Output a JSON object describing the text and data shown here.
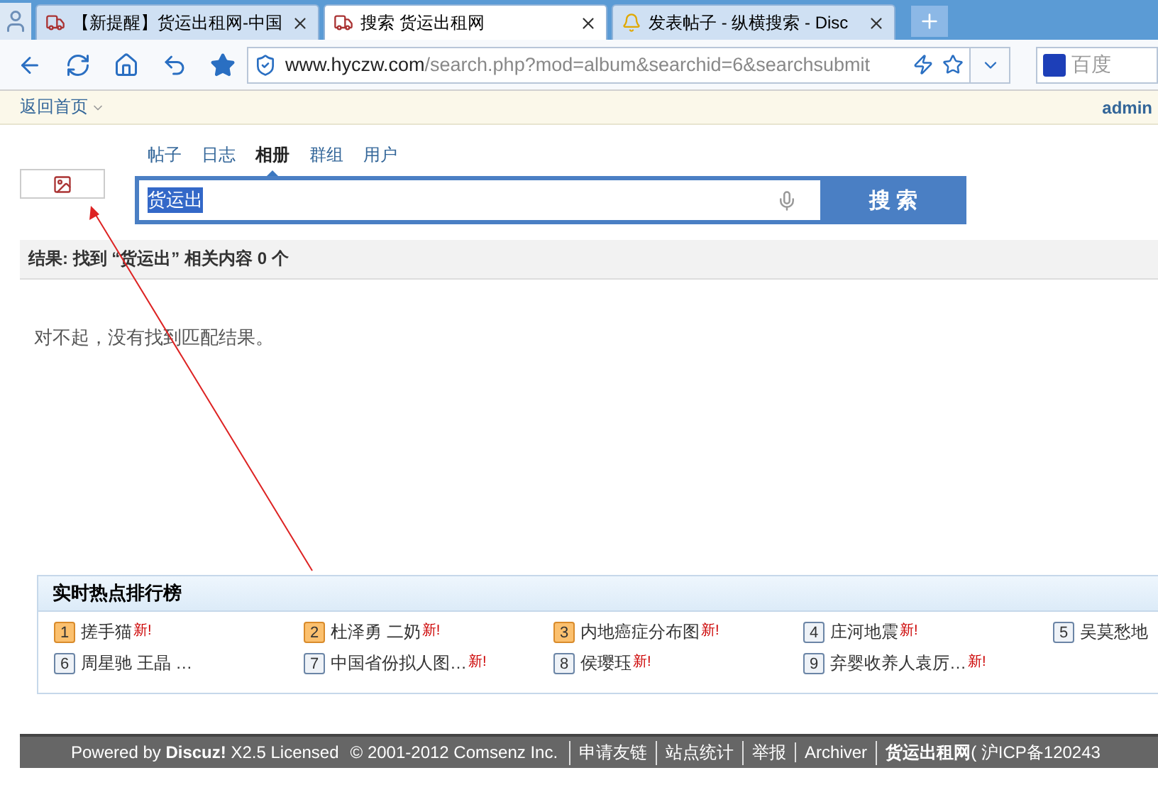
{
  "browser_tabs": [
    {
      "title": "【新提醒】货运出租网-中国",
      "selected": false
    },
    {
      "title": "搜索 货运出租网",
      "selected": true
    },
    {
      "title": "发表帖子 - 纵横搜索 - Disc",
      "selected": false
    }
  ],
  "address_bar": {
    "domain": "www.hyczw.com",
    "path": "/search.php?mod=album&searchid=6&searchsubmit"
  },
  "browser_search": {
    "placeholder": "百度"
  },
  "bookmark_bar": {
    "home_link": "返回首页",
    "user": "admin"
  },
  "search_types": [
    {
      "label": "帖子",
      "selected": false
    },
    {
      "label": "日志",
      "selected": false
    },
    {
      "label": "相册",
      "selected": true
    },
    {
      "label": "群组",
      "selected": false
    },
    {
      "label": "用户",
      "selected": false
    }
  ],
  "search": {
    "value": "货运出",
    "button": "搜 索"
  },
  "results": {
    "summary": "结果: 找到 “货运出” 相关内容 **0** 个",
    "message": "对不起，没有找到匹配结果。"
  },
  "hot_list": {
    "title": "实时热点排行榜",
    "items": [
      {
        "rank": "1",
        "text": "搓手猫",
        "top": true,
        "new_label": "新!"
      },
      {
        "rank": "2",
        "text": "杜泽勇 二奶",
        "top": true,
        "new_label": "新!"
      },
      {
        "rank": "3",
        "text": "内地癌症分布图",
        "top": true,
        "new_label": "新!"
      },
      {
        "rank": "4",
        "text": "庄河地震",
        "top": false,
        "new_label": "新!"
      },
      {
        "rank": "5",
        "text": "吴莫愁地",
        "top": false
      },
      {
        "rank": "6",
        "text": "周星驰 王晶 …",
        "top": false
      },
      {
        "rank": "7",
        "text": "中国省份拟人图…",
        "top": false,
        "new_label": "新!"
      },
      {
        "rank": "8",
        "text": "侯璎珏",
        "top": false,
        "new_label": "新!"
      },
      {
        "rank": "9",
        "text": "弃婴收养人袁厉…",
        "top": false,
        "new_label": "新!"
      }
    ]
  },
  "footer": {
    "powered": "Powered by **Discuz!** X2.5 Licensed",
    "copyright": "© 2001-2012 Comsenz Inc.",
    "links": [
      "申请友链",
      "站点统计",
      "举报",
      "Archiver"
    ],
    "site": "货运出租网",
    "icp": "( 沪ICP备120243"
  }
}
